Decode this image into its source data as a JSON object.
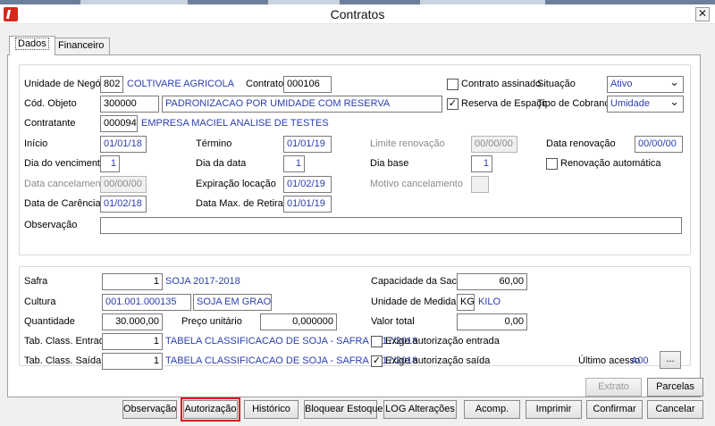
{
  "window": {
    "title": "Contratos",
    "close_glyph": "✕"
  },
  "tabs": [
    "Dados",
    "Financeiro"
  ],
  "main": {
    "unidade_label": "Unidade de Negócio",
    "unidade_code": "802",
    "unidade_name": "COLTIVARE AGRICOLA",
    "contrato_label": "Contrato",
    "contrato_value": "000106",
    "contrato_assinado_label": "Contrato assinado",
    "contrato_assinado_checked": "",
    "situacao_label": "Situação",
    "situacao_value": "Ativo",
    "cod_objeto_label": "Cód. Objeto",
    "cod_objeto_value": "300000",
    "cod_objeto_desc": "PADRONIZACAO POR UMIDADE COM RESERVA",
    "reserva_label": "Reserva de Espaço",
    "reserva_checked": "✓",
    "tipo_cobranca_label": "Tipo de Cobrança",
    "tipo_cobranca_value": "Umidade",
    "contratante_label": "Contratante",
    "contratante_code": "000094",
    "contratante_name": "EMPRESA MACIEL ANALISE DE TESTES",
    "inicio_label": "Início",
    "inicio_value": "01/01/18",
    "termino_label": "Término",
    "termino_value": "01/01/19",
    "limite_label": "Limite renovação",
    "limite_value": "00/00/00",
    "data_renovacao_label": "Data renovação",
    "data_renovacao_value": "00/00/00",
    "dia_venc_label": "Dia do vencimento",
    "dia_venc_value": "1",
    "dia_data_label": "Dia da data",
    "dia_data_value": "1",
    "dia_base_label": "Dia base",
    "dia_base_value": "1",
    "renov_auto_label": "Renovação automática",
    "renov_auto_checked": "",
    "data_cancel_label": "Data cancelamento",
    "data_cancel_value": "00/00/00",
    "expiracao_label": "Expiração locação",
    "expiracao_value": "01/02/19",
    "motivo_label": "Motivo cancelamento",
    "motivo_value": "",
    "carencia_label": "Data de Carência",
    "carencia_value": "01/02/18",
    "data_max_label": "Data Max. de Retirada",
    "data_max_value": "01/01/19",
    "observacao_label": "Observação",
    "observacao_value": ""
  },
  "product": {
    "safra_label": "Safra",
    "safra_code": "1",
    "safra_name": "SOJA 2017-2018",
    "capacidade_label": "Capacidade da Saca",
    "capacidade_value": "60,00",
    "cultura_label": "Cultura",
    "cultura_code": "001.001.000135",
    "cultura_name": "SOJA EM GRAOS",
    "unidade_medida_label": "Unidade de Medida",
    "unidade_medida_code": "KG",
    "unidade_medida_name": "KILO",
    "quantidade_label": "Quantidade",
    "quantidade_value": "30.000,00",
    "preco_label": "Preço unitário",
    "preco_value": "0,000000",
    "valor_total_label": "Valor total",
    "valor_total_value": "0,00",
    "tab_entrada_label": "Tab. Class. Entrada",
    "tab_entrada_code": "1",
    "tab_entrada_name": "TABELA CLASSIFICACAO DE SOJA - SAFRA 2017/2018",
    "exige_entrada_label": "Exige autorização entrada",
    "exige_entrada_checked": "",
    "tab_saida_label": "Tab. Class. Saída",
    "tab_saida_code": "1",
    "tab_saida_name": "TABELA CLASSIFICACAO DE SOJA - SAFRA 2017/2018",
    "exige_saida_label": "Exige autorização saída",
    "exige_saida_checked": "✓",
    "ultimo_acesso_label": "Último acesso",
    "ultimo_acesso_value": "A00",
    "browse_label": "..."
  },
  "buttons": {
    "extrato": "Extrato",
    "parcelas": "Parcelas",
    "observacao": "Observação",
    "autorizacao": "Autorização",
    "historico": "Histórico",
    "bloquear": "Bloquear Estoque",
    "log": "LOG Alterações",
    "acomp": "Acomp.",
    "imprimir": "Imprimir",
    "confirmar": "Confirmar",
    "cancelar": "Cancelar"
  },
  "colors": {
    "accent_blue": "#2a3fae",
    "highlight_red": "#e0141b"
  }
}
